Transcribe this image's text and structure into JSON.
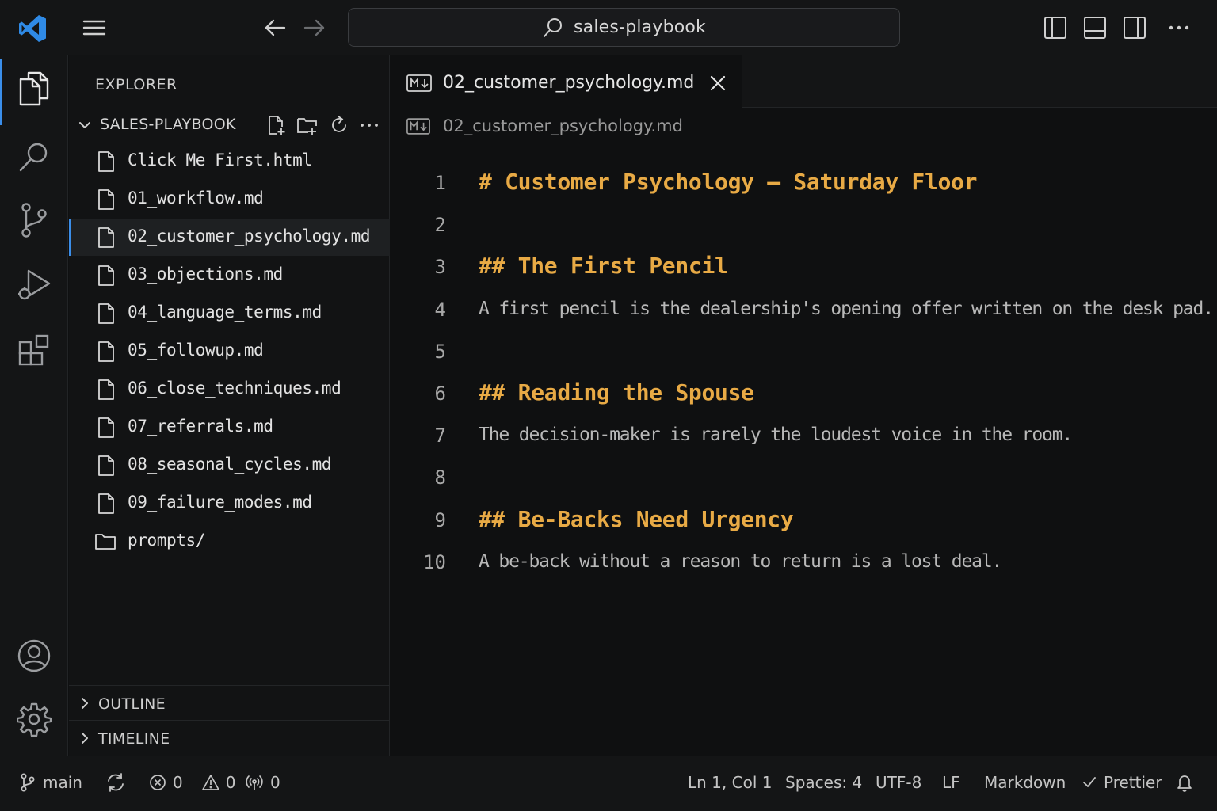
{
  "titlebar": {
    "search_text": "sales-playbook"
  },
  "icons": {
    "logo": "vscode-logo",
    "menu": "hamburger-menu-icon",
    "back": "arrow-left-icon",
    "forward": "arrow-right-icon",
    "search": "search-icon"
  },
  "sidebar": {
    "title": "EXPLORER",
    "folder_name": "SALES-PLAYBOOK",
    "files": [
      {
        "name": "Click_Me_First.html",
        "type": "file"
      },
      {
        "name": "01_workflow.md",
        "type": "file"
      },
      {
        "name": "02_customer_psychology.md",
        "type": "file",
        "selected": true
      },
      {
        "name": "03_objections.md",
        "type": "file"
      },
      {
        "name": "04_language_terms.md",
        "type": "file"
      },
      {
        "name": "05_followup.md",
        "type": "file"
      },
      {
        "name": "06_close_techniques.md",
        "type": "file"
      },
      {
        "name": "07_referrals.md",
        "type": "file"
      },
      {
        "name": "08_seasonal_cycles.md",
        "type": "file"
      },
      {
        "name": "09_failure_modes.md",
        "type": "file"
      },
      {
        "name": "prompts/",
        "type": "folder"
      }
    ],
    "panels": {
      "outline": "OUTLINE",
      "timeline": "TIMELINE"
    }
  },
  "editor": {
    "tab_label": "02_customer_psychology.md",
    "breadcrumb": "02_customer_psychology.md",
    "lines": [
      {
        "num": "1",
        "text": "# Customer Psychology — Saturday Floor",
        "kind": "h"
      },
      {
        "num": "2",
        "text": "",
        "kind": "p"
      },
      {
        "num": "3",
        "text": "## The First Pencil",
        "kind": "h"
      },
      {
        "num": "4",
        "text": "A first pencil is the dealership's opening offer written on the desk pad.",
        "kind": "p"
      },
      {
        "num": "5",
        "text": "",
        "kind": "p"
      },
      {
        "num": "6",
        "text": "## Reading the Spouse",
        "kind": "h"
      },
      {
        "num": "7",
        "text": "The decision-maker is rarely the loudest voice in the room.",
        "kind": "p"
      },
      {
        "num": "8",
        "text": "",
        "kind": "p"
      },
      {
        "num": "9",
        "text": "## Be-Backs Need Urgency",
        "kind": "h"
      },
      {
        "num": "10",
        "text": "A be-back without a reason to return is a lost deal.",
        "kind": "p"
      }
    ]
  },
  "statusbar": {
    "branch": "main",
    "errors": "0",
    "warnings": "0",
    "ports": "0",
    "cursor": "Ln 1, Col 1",
    "spaces": "Spaces: 4",
    "encoding": "UTF-8",
    "eol": "LF",
    "language": "Markdown",
    "formatter": "Prettier"
  },
  "colors": {
    "accent": "#3b8eea",
    "heading": "#e8aa45",
    "body_text": "#b8b8b8",
    "background": "#0f1011"
  }
}
